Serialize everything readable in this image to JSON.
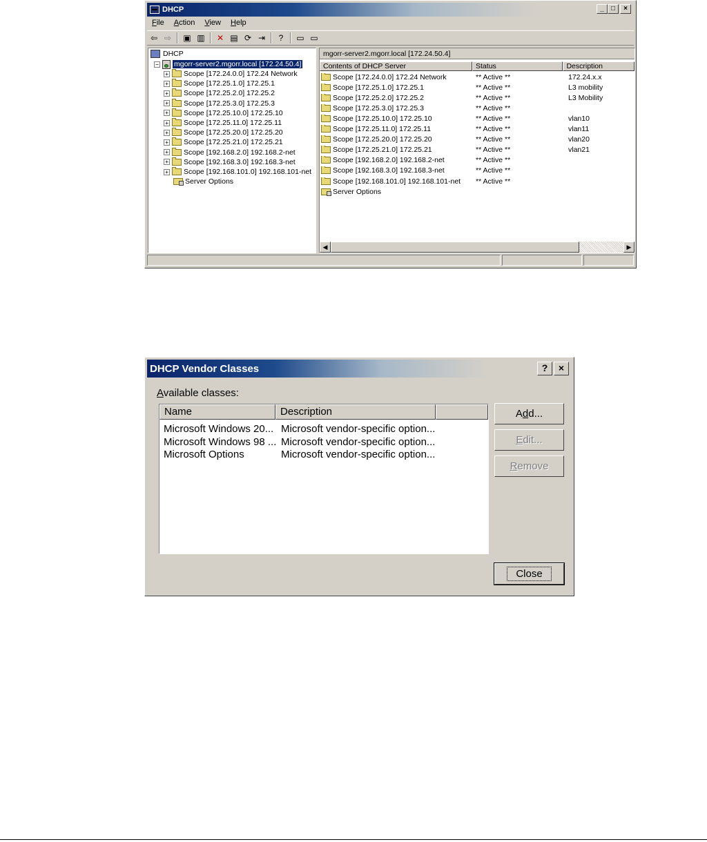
{
  "dhcp_window": {
    "title": "DHCP",
    "menu": [
      "File",
      "Action",
      "View",
      "Help"
    ],
    "menu_accel": [
      "F",
      "A",
      "V",
      "H"
    ],
    "tree": {
      "root": "DHCP",
      "server": "mgorr-server2.mgorr.local [172.24.50.4]",
      "scopes": [
        "Scope [172.24.0.0] 172.24 Network",
        "Scope [172.25.1.0] 172.25.1",
        "Scope [172.25.2.0] 172.25.2",
        "Scope [172.25.3.0] 172.25.3",
        "Scope [172.25.10.0] 172.25.10",
        "Scope [172.25.11.0] 172.25.11",
        "Scope [172.25.20.0] 172.25.20",
        "Scope [172.25.21.0] 172.25.21",
        "Scope [192.168.2.0] 192.168.2-net",
        "Scope [192.168.3.0] 192.168.3-net",
        "Scope [192.168.101.0] 192.168.101-net"
      ],
      "server_options": "Server Options"
    },
    "list": {
      "caption": "mgorr-server2.mgorr.local [172.24.50.4]",
      "columns": [
        "Contents of DHCP Server",
        "Status",
        "Description"
      ],
      "rows": [
        {
          "name": "Scope [172.24.0.0] 172.24 Network",
          "status": "** Active **",
          "description": "172.24.x.x"
        },
        {
          "name": "Scope [172.25.1.0] 172.25.1",
          "status": "** Active **",
          "description": "L3 mobility"
        },
        {
          "name": "Scope [172.25.2.0] 172.25.2",
          "status": "** Active **",
          "description": "L3 Mobility"
        },
        {
          "name": "Scope [172.25.3.0] 172.25.3",
          "status": "** Active **",
          "description": ""
        },
        {
          "name": "Scope [172.25.10.0] 172.25.10",
          "status": "** Active **",
          "description": "vlan10"
        },
        {
          "name": "Scope [172.25.11.0] 172.25.11",
          "status": "** Active **",
          "description": "vlan11"
        },
        {
          "name": "Scope [172.25.20.0] 172.25.20",
          "status": "** Active **",
          "description": "vlan20"
        },
        {
          "name": "Scope [172.25.21.0] 172.25.21",
          "status": "** Active **",
          "description": "vlan21"
        },
        {
          "name": "Scope [192.168.2.0] 192.168.2-net",
          "status": "** Active **",
          "description": ""
        },
        {
          "name": "Scope [192.168.3.0] 192.168.3-net",
          "status": "** Active **",
          "description": ""
        },
        {
          "name": "Scope [192.168.101.0] 192.168.101-net",
          "status": "** Active **",
          "description": ""
        }
      ],
      "server_options": "Server Options"
    }
  },
  "vendor_dialog": {
    "title": "DHCP Vendor Classes",
    "available_label": "Available classes:",
    "columns": [
      "Name",
      "Description"
    ],
    "rows": [
      {
        "name": "Microsoft Windows 20...",
        "description": "Microsoft vendor-specific option..."
      },
      {
        "name": "Microsoft Windows 98 ...",
        "description": "Microsoft vendor-specific option..."
      },
      {
        "name": "Microsoft Options",
        "description": "Microsoft vendor-specific option..."
      }
    ],
    "buttons": {
      "add": "Add...",
      "edit": "Edit...",
      "remove": "Remove",
      "close": "Close"
    },
    "help_glyph": "?",
    "close_glyph": "×"
  },
  "colors": {
    "selection": "#0a246a",
    "face": "#d4d0c8",
    "title_start": "#0a246a"
  }
}
